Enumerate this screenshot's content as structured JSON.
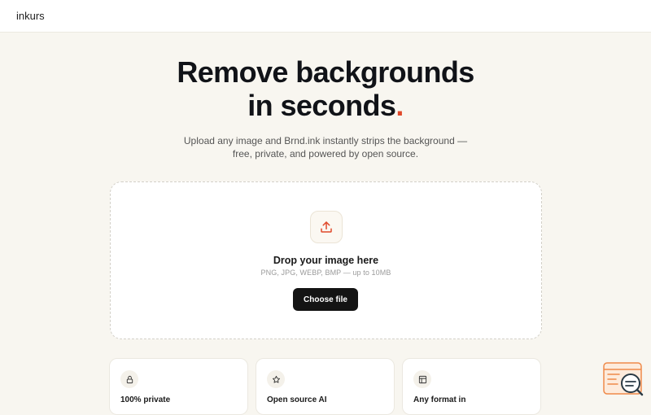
{
  "header": {
    "brand": "inkurs"
  },
  "hero": {
    "title_line1": "Remove backgrounds",
    "title_line2": "in seconds",
    "title_dot": ".",
    "subtitle_line1": "Upload any image and Brnd.ink instantly strips the background —",
    "subtitle_line2": "free, private, and powered by open source."
  },
  "dropzone": {
    "icon": "upload-icon",
    "title": "Drop your image here",
    "hint": "PNG, JPG, WEBP, BMP — up to 10MB",
    "button_label": "Choose file"
  },
  "features": [
    {
      "icon": "lock-icon",
      "title": "100% private"
    },
    {
      "icon": "star-icon",
      "title": "Open source AI"
    },
    {
      "icon": "layout-icon",
      "title": "Any format in"
    }
  ],
  "colors": {
    "background": "#f8f6f0",
    "accent": "#e0482a",
    "button": "#141414"
  }
}
